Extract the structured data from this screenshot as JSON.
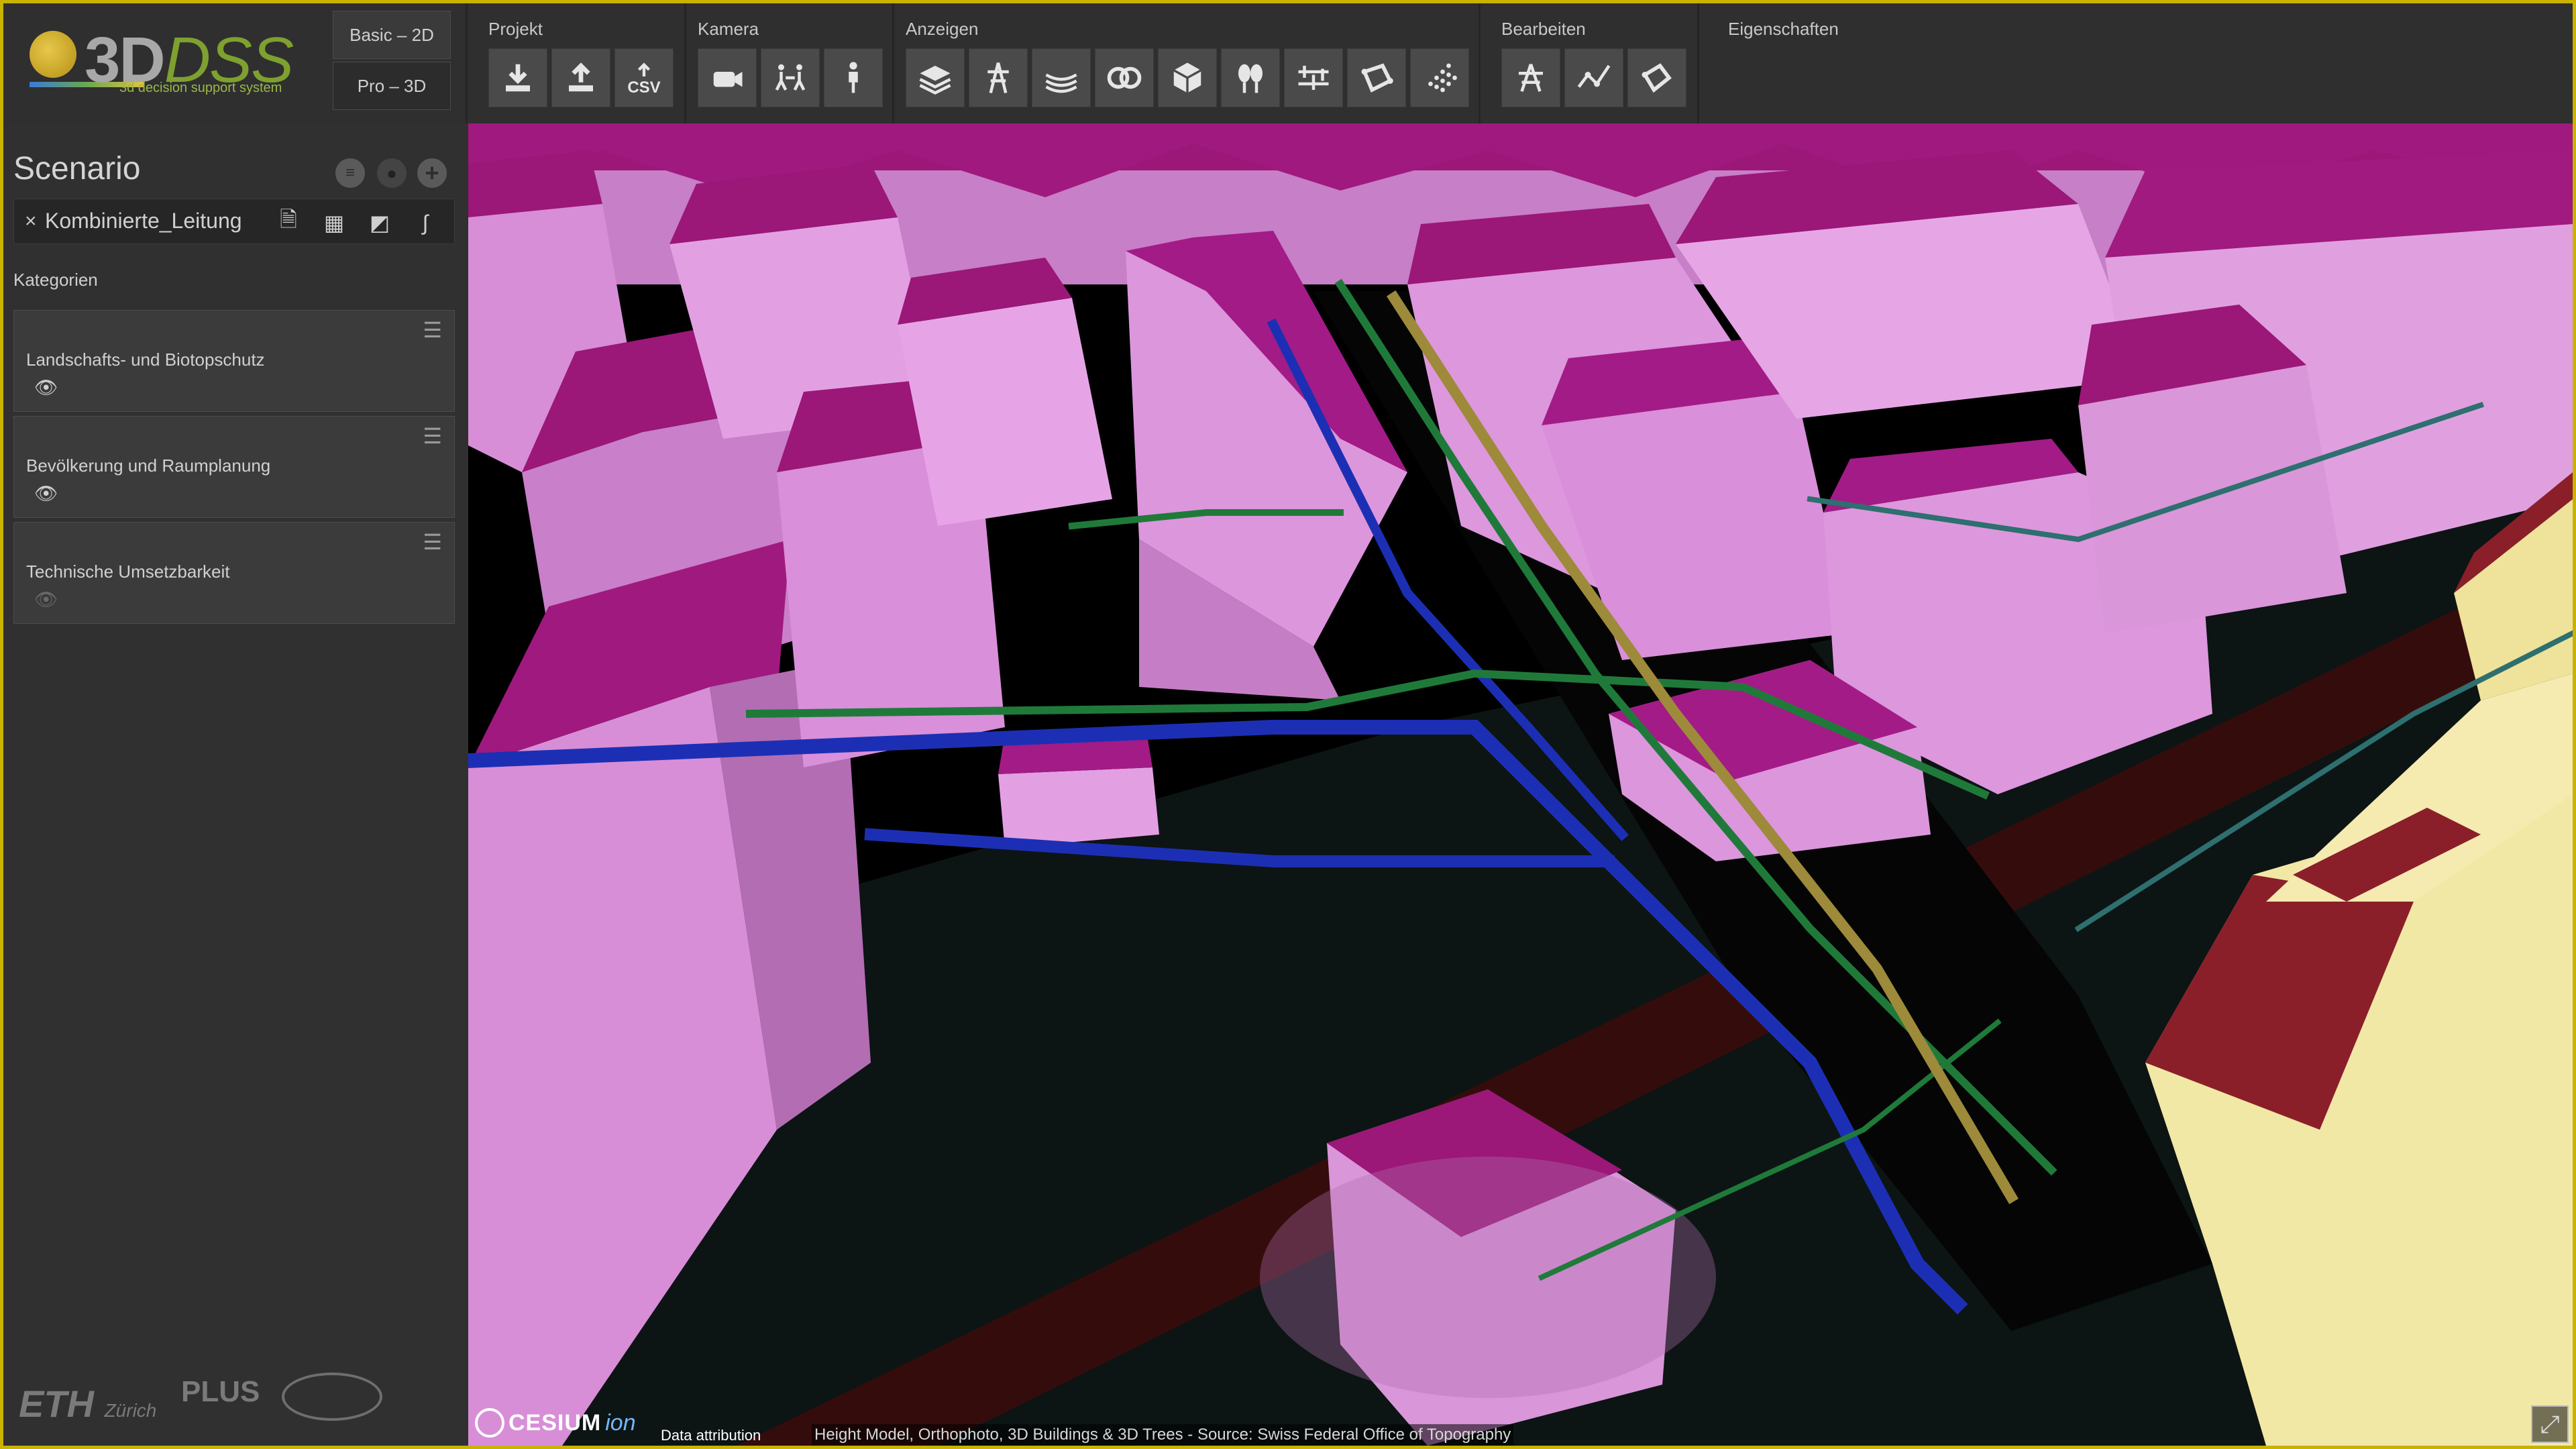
{
  "logo": {
    "brand_main": "3D",
    "brand_accent": "DSS",
    "tagline": "3d decision support system"
  },
  "modes": {
    "basic": "Basic – 2D",
    "pro": "Pro – 3D"
  },
  "toolbar": {
    "projekt": {
      "label": "Projekt",
      "csv_label": "CSV"
    },
    "kamera": {
      "label": "Kamera"
    },
    "anzeigen": {
      "label": "Anzeigen"
    },
    "bearbeiten": {
      "label": "Bearbeiten"
    },
    "eigenschaften": {
      "label": "Eigenschaften"
    }
  },
  "sidebar": {
    "title": "Scenario",
    "scenario_name": "Kombinierte_Leitung",
    "close_symbol": "×",
    "categories_label": "Kategorien",
    "categories": [
      {
        "name": "Landschafts- und Biotopschutz",
        "visible": true
      },
      {
        "name": "Bevölkerung und Raumplanung",
        "visible": true
      },
      {
        "name": "Technische Umsetzbarkeit",
        "visible": false
      }
    ],
    "footer": {
      "eth": "ETH",
      "eth_sub": "Zürich",
      "plus": "PLUS"
    }
  },
  "viewport": {
    "cesium_text": "CESIUM",
    "cesium_ion": "ion",
    "attribution_link": "Data attribution",
    "credit": "Height Model, Orthophoto, 3D Buildings & 3D Trees - Source: Swiss Federal Office of Topography"
  },
  "colors": {
    "accent": "#c9b200",
    "building_wall": "#d88fd8",
    "building_roof": "#9b1778",
    "highlight_wall": "#f2e8a6",
    "highlight_roof": "#8a1f2a",
    "pipe_green": "#1f7a3a",
    "pipe_blue": "#1c2fb4",
    "pipe_yellow": "#9d8a3a"
  }
}
